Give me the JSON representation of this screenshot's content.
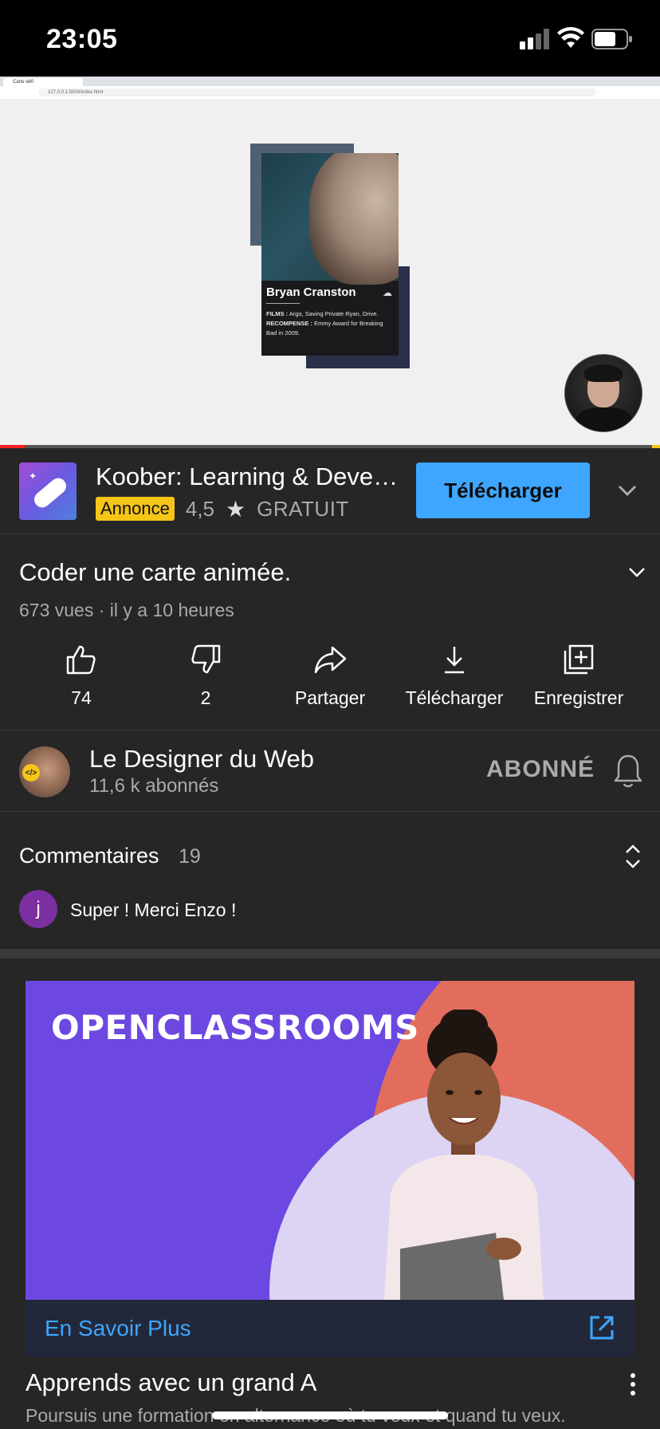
{
  "status_bar": {
    "time": "23:05"
  },
  "video": {
    "browser_tab": "Carte défi",
    "browser_url": "127.0.0.1:5500/index.html",
    "card": {
      "name": "Bryan Cranston",
      "films_label": "FILMS :",
      "films": "Argo, Saving Private Ryan, Drive.",
      "award_label": "RECOMPENSE :",
      "award": "Emmy Award for Breaking Bad in 2009."
    },
    "progress_fraction": 0.037
  },
  "ad": {
    "title": "Koober: Learning & Devel…",
    "badge": "Annonce",
    "rating": "4,5",
    "price": "GRATUIT",
    "button": "Télécharger"
  },
  "video_info": {
    "title": "Coder une carte animée.",
    "meta": "673 vues · il y a 10 heures",
    "actions": [
      {
        "icon": "thumbs-up-icon",
        "label": "74"
      },
      {
        "icon": "thumbs-down-icon",
        "label": "2"
      },
      {
        "icon": "share-icon",
        "label": "Partager"
      },
      {
        "icon": "download-icon",
        "label": "Télécharger"
      },
      {
        "icon": "save-icon",
        "label": "Enregistrer"
      }
    ]
  },
  "channel": {
    "name": "Le Designer du Web",
    "subscribers": "11,6 k abonnés",
    "subscribe_state": "ABONNÉ"
  },
  "comments": {
    "heading": "Commentaires",
    "count": "19",
    "first": {
      "avatar_letter": "j",
      "text": "Super ! Merci Enzo !"
    }
  },
  "promo": {
    "logo": "OPENCLASSROOMS",
    "cta": "En Savoir Plus",
    "title": "Apprends avec un grand A",
    "description": "Poursuis une formation en alternance où tu veux et quand tu veux."
  },
  "colors": {
    "accent": "#3ea6ff",
    "ad_badge": "#f5c518",
    "progress": "#ff1f1f",
    "background": "#262626"
  }
}
